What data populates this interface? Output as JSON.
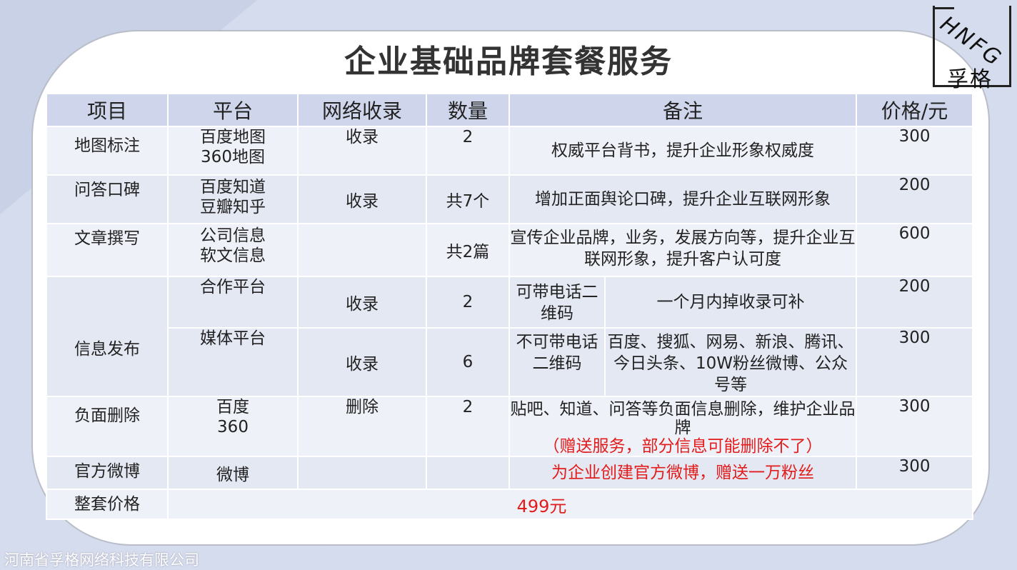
{
  "title": "企业基础品牌套餐服务",
  "logo": {
    "mark": "HNFG",
    "name": "孚格"
  },
  "company": "河南省孚格网络科技有限公司",
  "headers": [
    "项目",
    "平台",
    "网络收录",
    "数量",
    "备注",
    "价格/元"
  ],
  "rows": {
    "map": {
      "item": "地图标注",
      "platform1": "百度地图",
      "platform2": "360地图",
      "index": "收录",
      "qty": "2",
      "note": "权威平台背书，提升企业形象权威度",
      "price": "300"
    },
    "qa": {
      "item": "问答口碑",
      "platform1": "百度知道",
      "platform2": "豆瓣知乎",
      "index": "收录",
      "qty": "共7个",
      "note": "增加正面舆论口碑，提升企业互联网形象",
      "price": "200"
    },
    "article": {
      "item": "文章撰写",
      "platform1": "公司信息",
      "platform2": "软文信息",
      "index": "",
      "qty": "共2篇",
      "note": "宣传企业品牌，业务，发展方向等，提升企业互联网形象，提升客户认可度",
      "price": "600"
    },
    "info": {
      "item": "信息发布",
      "coop": {
        "platform": "合作平台",
        "index": "收录",
        "qty": "2",
        "note_a": "可带电话二维码",
        "note_b": "一个月内掉收录可补",
        "price": "200"
      },
      "media": {
        "platform": "媒体平台",
        "index": "收录",
        "qty": "6",
        "note_a": "不可带电话二维码",
        "note_b": "百度、搜狐、网易、新浪、腾讯、今日头条、10W粉丝微博、公众号等",
        "price": "300"
      }
    },
    "delete": {
      "item": "负面删除",
      "platform1": "百度",
      "platform2": "360",
      "index": "删除",
      "qty": "2",
      "note": "贴吧、知道、问答等负面信息删除，维护企业品牌",
      "note_red": "（赠送服务，部分信息可能删除不了）",
      "price": "300"
    },
    "weibo": {
      "item": "官方微博",
      "platform": "微博",
      "index": "",
      "qty": "",
      "note_red": "为企业创建官方微博，赠送一万粉丝",
      "price": "300"
    },
    "total": {
      "item": "整套价格",
      "price": "499元"
    }
  },
  "colors": {
    "header_bg": "#cfd5ea",
    "row_bg": "#eef1f8",
    "accent_red": "#e21b1b",
    "page_bg": "#d5dced"
  }
}
